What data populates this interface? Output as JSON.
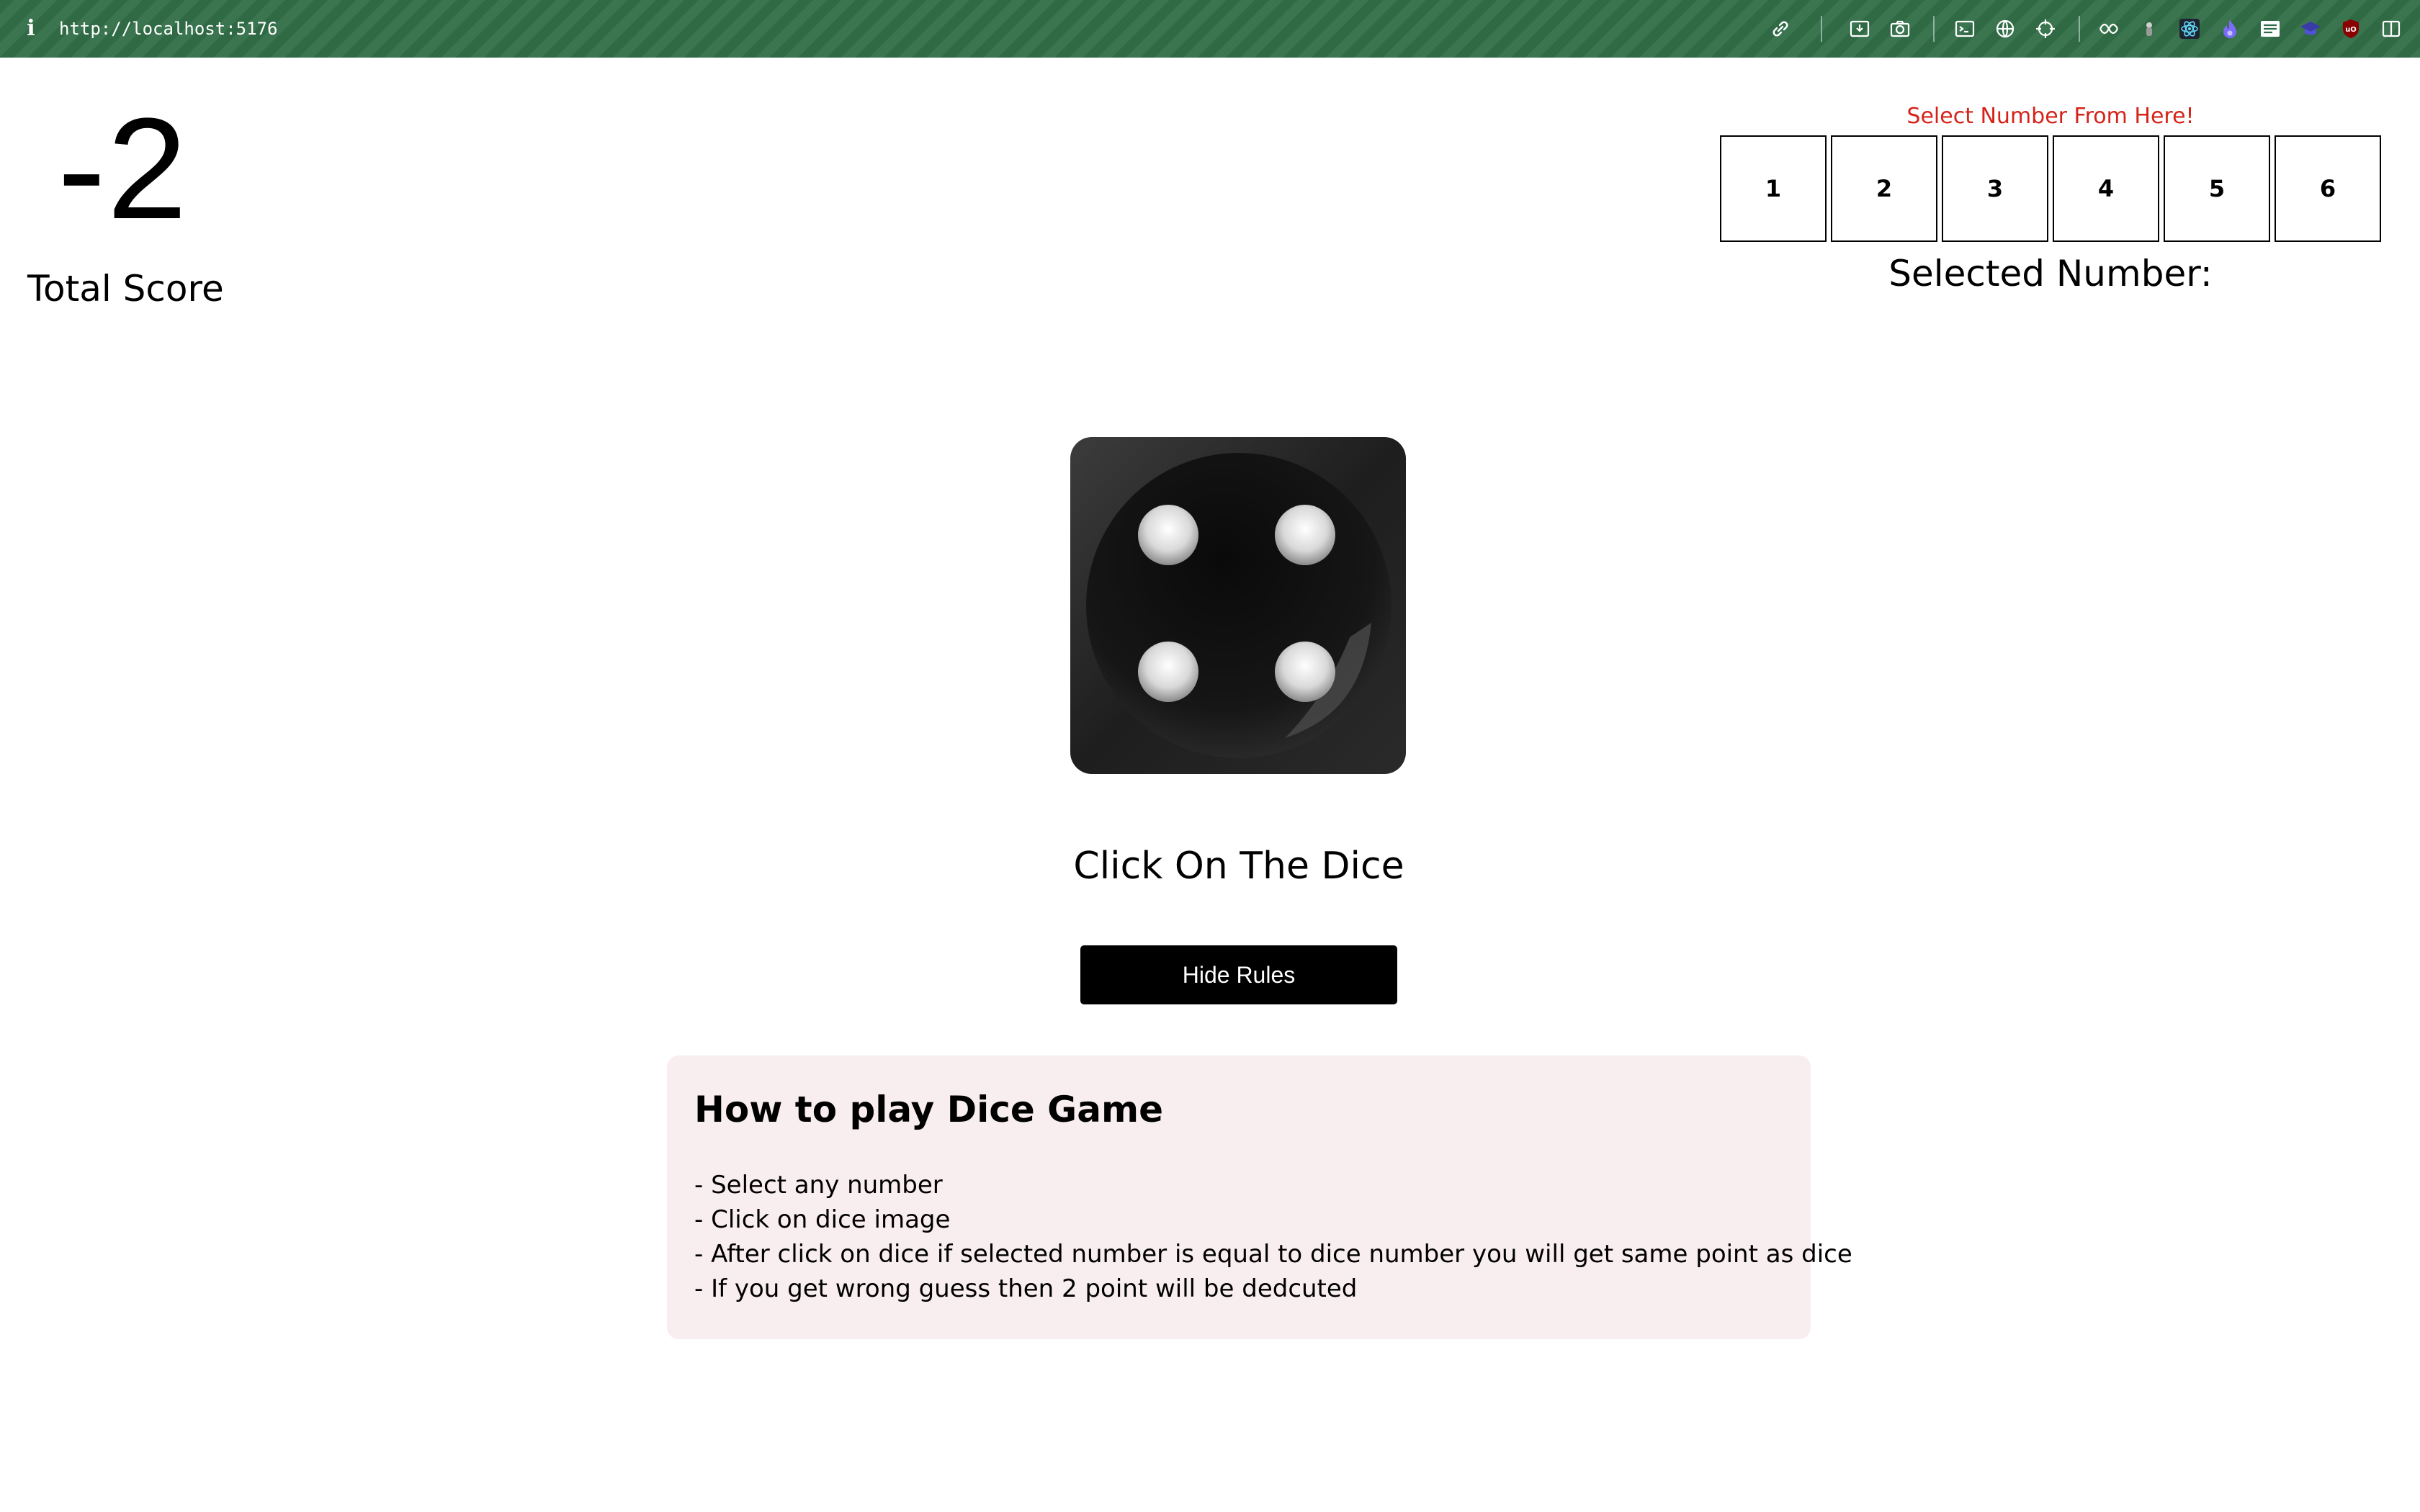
{
  "browser": {
    "url": "http://localhost:5176",
    "info_icon": "i",
    "toolbar_icons": [
      "link-icon",
      "save-icon",
      "camera-icon",
      "terminal-icon",
      "globe-icon",
      "crosshair-icon",
      "extensions-icon",
      "pin-icon",
      "react-icon",
      "flame-icon",
      "mail-icon",
      "graduation-icon",
      "ublock-icon",
      "sidebar-icon"
    ]
  },
  "score": {
    "value": "-2",
    "label": "Total Score"
  },
  "selector": {
    "hint": "Select Number From Here!",
    "hint_color": "#d6231a",
    "numbers": [
      "1",
      "2",
      "3",
      "4",
      "5",
      "6"
    ],
    "selected_label": "Selected Number:"
  },
  "dice": {
    "face": 4,
    "instruction": "Click On The Dice"
  },
  "rules_button": {
    "label": "Hide Rules"
  },
  "rules": {
    "title": "How to play Dice Game",
    "lines": [
      "- Select any number",
      "- Click on dice image",
      "- After click on dice if selected number is equal to dice number you will get same point as dice",
      "- If you get wrong guess then 2 point will be dedcuted"
    ]
  },
  "colors": {
    "toolbar": "#2f6a45",
    "rules_panel_bg": "#f9eeef",
    "button_bg": "#000000"
  }
}
